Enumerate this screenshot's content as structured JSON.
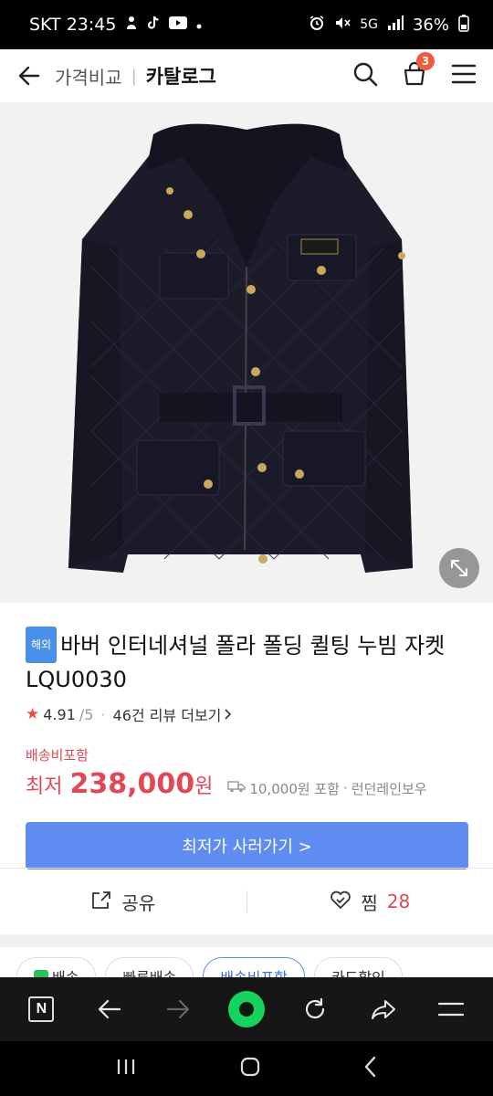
{
  "status_bar": {
    "carrier_time": "SKT 23:45",
    "notif_icons": [
      "person-icon",
      "tiktok-icon",
      "youtube-icon",
      "dot-icon"
    ],
    "right_icons": [
      "alarm-icon",
      "mute-icon",
      "5g-icon",
      "signal-icon"
    ],
    "network": "5G",
    "battery": "36%"
  },
  "header": {
    "crumb": "가격비교",
    "title": "카탈로그",
    "cart_count": "3"
  },
  "product": {
    "badge": "해외",
    "title": "바버 인터네셔널 폴라 폴딩 퀼팅 누빔 자켓 LQU0030",
    "rating": "4.91",
    "rating_max": "/5",
    "review_text": "46건 리뷰 더보기",
    "shipping_included": "배송비포함",
    "price_label": "최저",
    "price": "238,000",
    "price_unit": "원",
    "shipping_fee": "10,000원 포함",
    "seller": "런던레인보우",
    "cta_label": "최저가 사러가기 >"
  },
  "actions": {
    "share_label": "공유",
    "zzim_label": "찜",
    "zzim_count": "28"
  },
  "chips": [
    "배송",
    "빠른배송",
    "배송비포함",
    "카드할인"
  ],
  "colors": {
    "accent_blue": "#5f8cf0",
    "price_red": "#e0485a",
    "badge_blue": "#4a8fe8",
    "green": "#16d35e"
  }
}
